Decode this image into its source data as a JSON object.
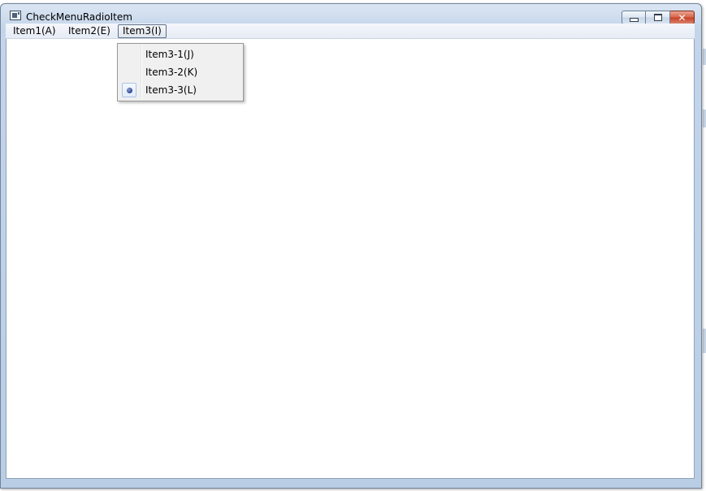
{
  "window": {
    "title": "CheckMenuRadioItem",
    "icon": "app-window-icon",
    "controls": {
      "minimize_icon": "minimize-icon",
      "maximize_icon": "maximize-icon",
      "close_glyph": "✕"
    }
  },
  "menubar": {
    "items": [
      {
        "label": "Item1(A)"
      },
      {
        "label": "Item2(E)"
      },
      {
        "label": "Item3(I)",
        "open": true
      }
    ]
  },
  "dropdown": {
    "items": [
      {
        "label": "Item3-1(J)",
        "checked": false
      },
      {
        "label": "Item3-2(K)",
        "checked": false
      },
      {
        "label": "Item3-3(L)",
        "checked": true
      }
    ]
  },
  "colors": {
    "frame": "#b9cde4",
    "menu_bg": "#f0f0f0",
    "radio_dot": "#2d3f8a",
    "close_button": "#c7452a"
  }
}
